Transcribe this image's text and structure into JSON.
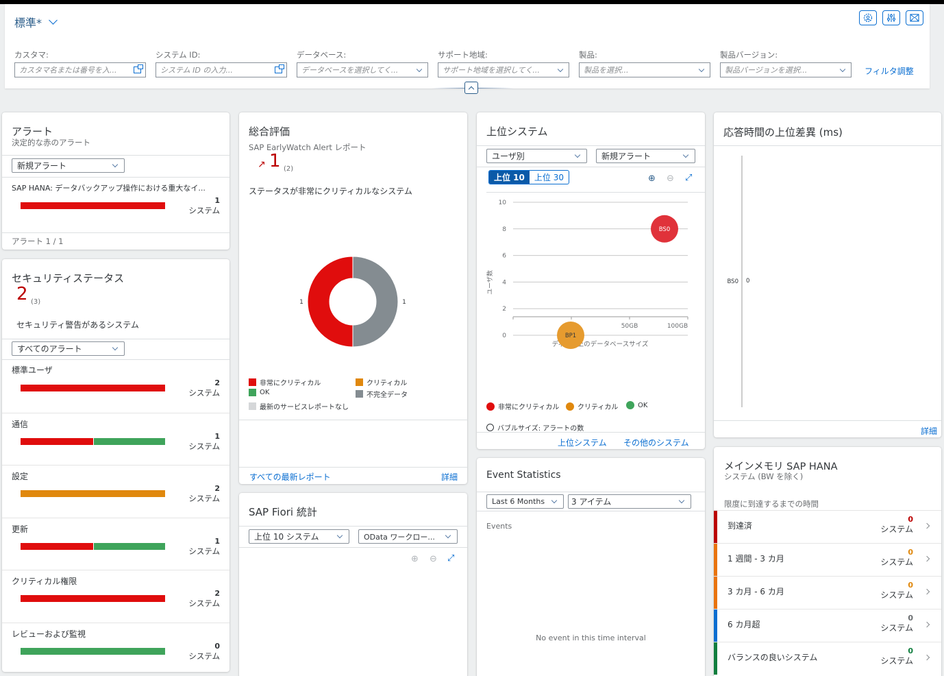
{
  "header": {
    "variant": "標準*",
    "icons": [
      "personalize-icon",
      "settings-sliders-icon",
      "email-icon"
    ],
    "filters": [
      {
        "label": "カスタマ:",
        "placeholder": "カスタマ名または番号を入...",
        "type": "valuehelp"
      },
      {
        "label": "システム ID:",
        "placeholder": "システム ID の入力...",
        "type": "valuehelp"
      },
      {
        "label": "データベース:",
        "placeholder": "データベースを選択してく...",
        "type": "select"
      },
      {
        "label": "サポート地域:",
        "placeholder": "サポート地域を選択してく...",
        "type": "select"
      },
      {
        "label": "製品:",
        "placeholder": "製品を選択...",
        "type": "select"
      },
      {
        "label": "製品バージョン:",
        "placeholder": "製品バージョンを選択...",
        "type": "select"
      }
    ],
    "adapt_filters": "フィルタ調整"
  },
  "alerts": {
    "title": "アラート",
    "subtitle": "決定的な赤のアラート",
    "select": "新規アラート",
    "item": {
      "label": "SAP HANA: データバックアップ操作における重大なイ...",
      "count": "1",
      "unit": "システム",
      "red": 1,
      "green": 0,
      "orange": 0
    },
    "footer": "アラート 1 / 1"
  },
  "security": {
    "title": "セキュリティステータス",
    "kpi": "2",
    "kpi_total": "(3)",
    "description": "セキュリティ警告があるシステム",
    "select": "すべてのアラート",
    "rows": [
      {
        "label": "標準ユーザ",
        "count": "2",
        "unit": "システム",
        "red": 1,
        "green": 0,
        "orange": 0
      },
      {
        "label": "通信",
        "count": "1",
        "unit": "システム",
        "red": 0.5,
        "green": 0.5,
        "orange": 0
      },
      {
        "label": "設定",
        "count": "2",
        "unit": "システム",
        "red": 0,
        "green": 0,
        "orange": 1
      },
      {
        "label": "更新",
        "count": "1",
        "unit": "システム",
        "red": 0.5,
        "green": 0.5,
        "orange": 0
      },
      {
        "label": "クリティカル権限",
        "count": "2",
        "unit": "システム",
        "red": 1,
        "green": 0,
        "orange": 0
      },
      {
        "label": "レビューおよび監視",
        "count": "0",
        "unit": "システム",
        "red": 0,
        "green": 1,
        "orange": 0
      }
    ]
  },
  "overall": {
    "title": "総合評価",
    "subtitle": "SAP EarlyWatch Alert レポート",
    "kpi": "1",
    "kpi_total": "(2)",
    "trend_icon": "trend-up-arrow",
    "description": "ステータスが非常にクリティカルなシステム",
    "legend": [
      {
        "label": "非常にクリティカル",
        "color": "#e00d0d"
      },
      {
        "label": "クリティカル",
        "color": "#e0880d"
      },
      {
        "label": "OK",
        "color": "#3fa45b"
      },
      {
        "label": "不完全データ",
        "color": "#848c91"
      },
      {
        "label": "最新のサービスレポートなし",
        "color": "#d5d7d9"
      }
    ],
    "footer_link": "すべての最新レポート",
    "details": "詳細"
  },
  "fiori": {
    "title": "SAP Fiori 統計",
    "select1": "上位 10 システム",
    "select2": "OData ワークロー..."
  },
  "top_systems": {
    "title": "上位システム",
    "select1": "ユーザ別",
    "select2": "新規アラート",
    "seg": [
      "上位 10",
      "上位 30"
    ],
    "seg_selected": 0,
    "legend": [
      {
        "label": "非常にクリティカル",
        "color": "#e00d0d"
      },
      {
        "label": "クリティカル",
        "color": "#e0880d"
      },
      {
        "label": "OK",
        "color": "#3fa45b"
      }
    ],
    "bubble_note": "バブルサイズ: アラートの数",
    "links": [
      "上位システム",
      "その他のシステム"
    ]
  },
  "events": {
    "title": "Event Statistics",
    "select1": "Last 6 Months",
    "select2": "3 アイテム",
    "chart_label": "Events",
    "empty": "No event in this time interval"
  },
  "response": {
    "title": "応答時間の上位差異 (ms)",
    "details": "詳細"
  },
  "memory": {
    "title": "メインメモリ SAP HANA",
    "subtitle": "システム (BW を除く)",
    "section": "限度に到達するまでの時間",
    "rows": [
      {
        "label": "到達済",
        "count": "0",
        "unit": "システム",
        "color": "#bb0000"
      },
      {
        "label": "1 週間 - 3 カ月",
        "count": "0",
        "unit": "システム",
        "color": "#e9730c"
      },
      {
        "label": "3 カ月 - 6 カ月",
        "count": "0",
        "unit": "システム",
        "color": "#e9730c"
      },
      {
        "label": "6 カ月超",
        "count": "0",
        "unit": "システム",
        "color": "#0a6ed1"
      },
      {
        "label": "バランスの良いシステム",
        "count": "0",
        "unit": "システム",
        "color": "#107e3e"
      }
    ]
  },
  "chart_data": [
    {
      "type": "pie",
      "title": "総合評価",
      "donut": true,
      "categories": [
        "非常にクリティカル",
        "不完全データ"
      ],
      "values": [
        1,
        1
      ],
      "colors": [
        "#e00d0d",
        "#848c91"
      ]
    },
    {
      "type": "scatter",
      "title": "上位システム",
      "xlabel": "ディクス上のデータベースサイズ",
      "ylabel": "ユーザ数",
      "x_ticks": [
        "0",
        "50GB",
        "100GB"
      ],
      "y_ticks": [
        0,
        2,
        4,
        6,
        8,
        10
      ],
      "ylim": [
        0,
        10
      ],
      "xlim_gb": [
        -50,
        100
      ],
      "grid": true,
      "points": [
        {
          "label": "BS0",
          "x_gb": 85,
          "y": 8,
          "status": "非常にクリティカル",
          "color": "#e0323a"
        },
        {
          "label": "BP1",
          "x_gb": 0,
          "y": 0,
          "status": "クリティカル",
          "color": "#e69b2f"
        }
      ]
    },
    {
      "type": "bar",
      "title": "応答時間の上位差異 (ms)",
      "orientation": "horizontal",
      "categories": [
        "BS0"
      ],
      "values": [
        0
      ]
    }
  ]
}
